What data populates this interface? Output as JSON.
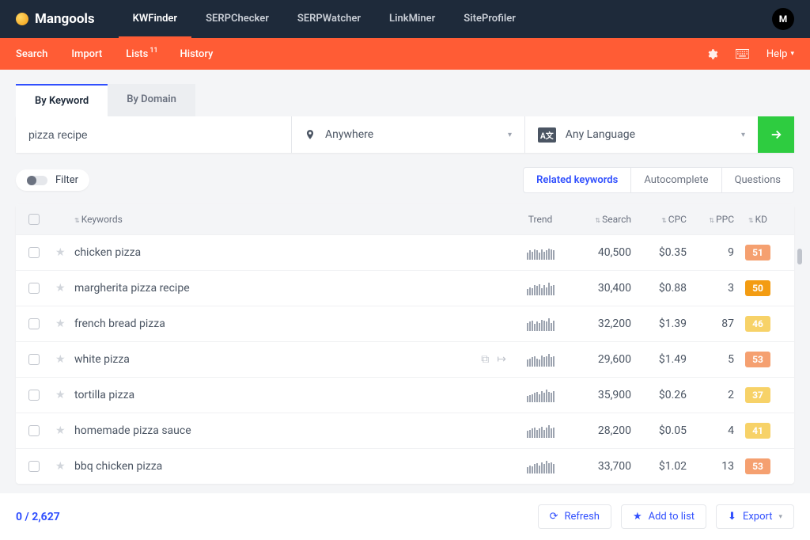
{
  "brand": "Mangools",
  "top_nav": [
    "KWFinder",
    "SERPChecker",
    "SERPWatcher",
    "LinkMiner",
    "SiteProfiler"
  ],
  "top_nav_active": 0,
  "avatar_letter": "M",
  "sub_nav": {
    "items": [
      "Search",
      "Import",
      "Lists",
      "History"
    ],
    "lists_badge": "11",
    "help_label": "Help"
  },
  "mode_tabs": [
    "By Keyword",
    "By Domain"
  ],
  "mode_tabs_active": 0,
  "search": {
    "keyword": "pizza recipe",
    "location": "Anywhere",
    "language": "Any Language"
  },
  "filter_label": "Filter",
  "kw_tabs": [
    "Related keywords",
    "Autocomplete",
    "Questions"
  ],
  "kw_tabs_active": 0,
  "columns": {
    "keywords": "Keywords",
    "trend": "Trend",
    "search": "Search",
    "cpc": "CPC",
    "ppc": "PPC",
    "kd": "KD"
  },
  "rows": [
    {
      "keyword": "chicken pizza",
      "search": "40,500",
      "cpc": "$0.35",
      "ppc": "9",
      "kd": 51,
      "kd_color": "#f5a070",
      "trend": [
        7,
        9,
        8,
        10,
        9,
        7,
        10,
        8,
        9,
        11,
        10,
        9
      ],
      "hover": false
    },
    {
      "keyword": "margherita pizza recipe",
      "search": "30,400",
      "cpc": "$0.88",
      "ppc": "3",
      "kd": 50,
      "kd_color": "#f39c12",
      "trend": [
        6,
        8,
        7,
        10,
        9,
        11,
        7,
        10,
        8,
        12,
        9,
        10
      ],
      "hover": false
    },
    {
      "keyword": "french bread pizza",
      "search": "32,200",
      "cpc": "$1.39",
      "ppc": "87",
      "kd": 46,
      "kd_color": "#f7d268",
      "trend": [
        8,
        9,
        10,
        7,
        9,
        8,
        11,
        10,
        9,
        12,
        8,
        10
      ],
      "hover": false
    },
    {
      "keyword": "white pizza",
      "search": "29,600",
      "cpc": "$1.49",
      "ppc": "5",
      "kd": 53,
      "kd_color": "#f5a070",
      "trend": [
        7,
        8,
        9,
        10,
        8,
        7,
        11,
        9,
        10,
        12,
        9,
        10
      ],
      "hover": true
    },
    {
      "keyword": "tortilla pizza",
      "search": "35,900",
      "cpc": "$0.26",
      "ppc": "2",
      "kd": 37,
      "kd_color": "#f7d268",
      "trend": [
        6,
        7,
        8,
        9,
        10,
        8,
        11,
        9,
        12,
        10,
        9,
        11
      ],
      "hover": false
    },
    {
      "keyword": "homemade pizza sauce",
      "search": "28,200",
      "cpc": "$0.05",
      "ppc": "4",
      "kd": 41,
      "kd_color": "#f7d268",
      "trend": [
        7,
        8,
        9,
        10,
        8,
        9,
        11,
        8,
        10,
        12,
        9,
        10
      ],
      "hover": false
    },
    {
      "keyword": "bbq chicken pizza",
      "search": "33,700",
      "cpc": "$1.02",
      "ppc": "13",
      "kd": 53,
      "kd_color": "#f5a070",
      "trend": [
        6,
        8,
        7,
        9,
        10,
        8,
        11,
        9,
        12,
        10,
        11,
        9
      ],
      "hover": false
    }
  ],
  "footer": {
    "selected": "0",
    "total": "2,627",
    "refresh_label": "Refresh",
    "addlist_label": "Add to list",
    "export_label": "Export"
  }
}
